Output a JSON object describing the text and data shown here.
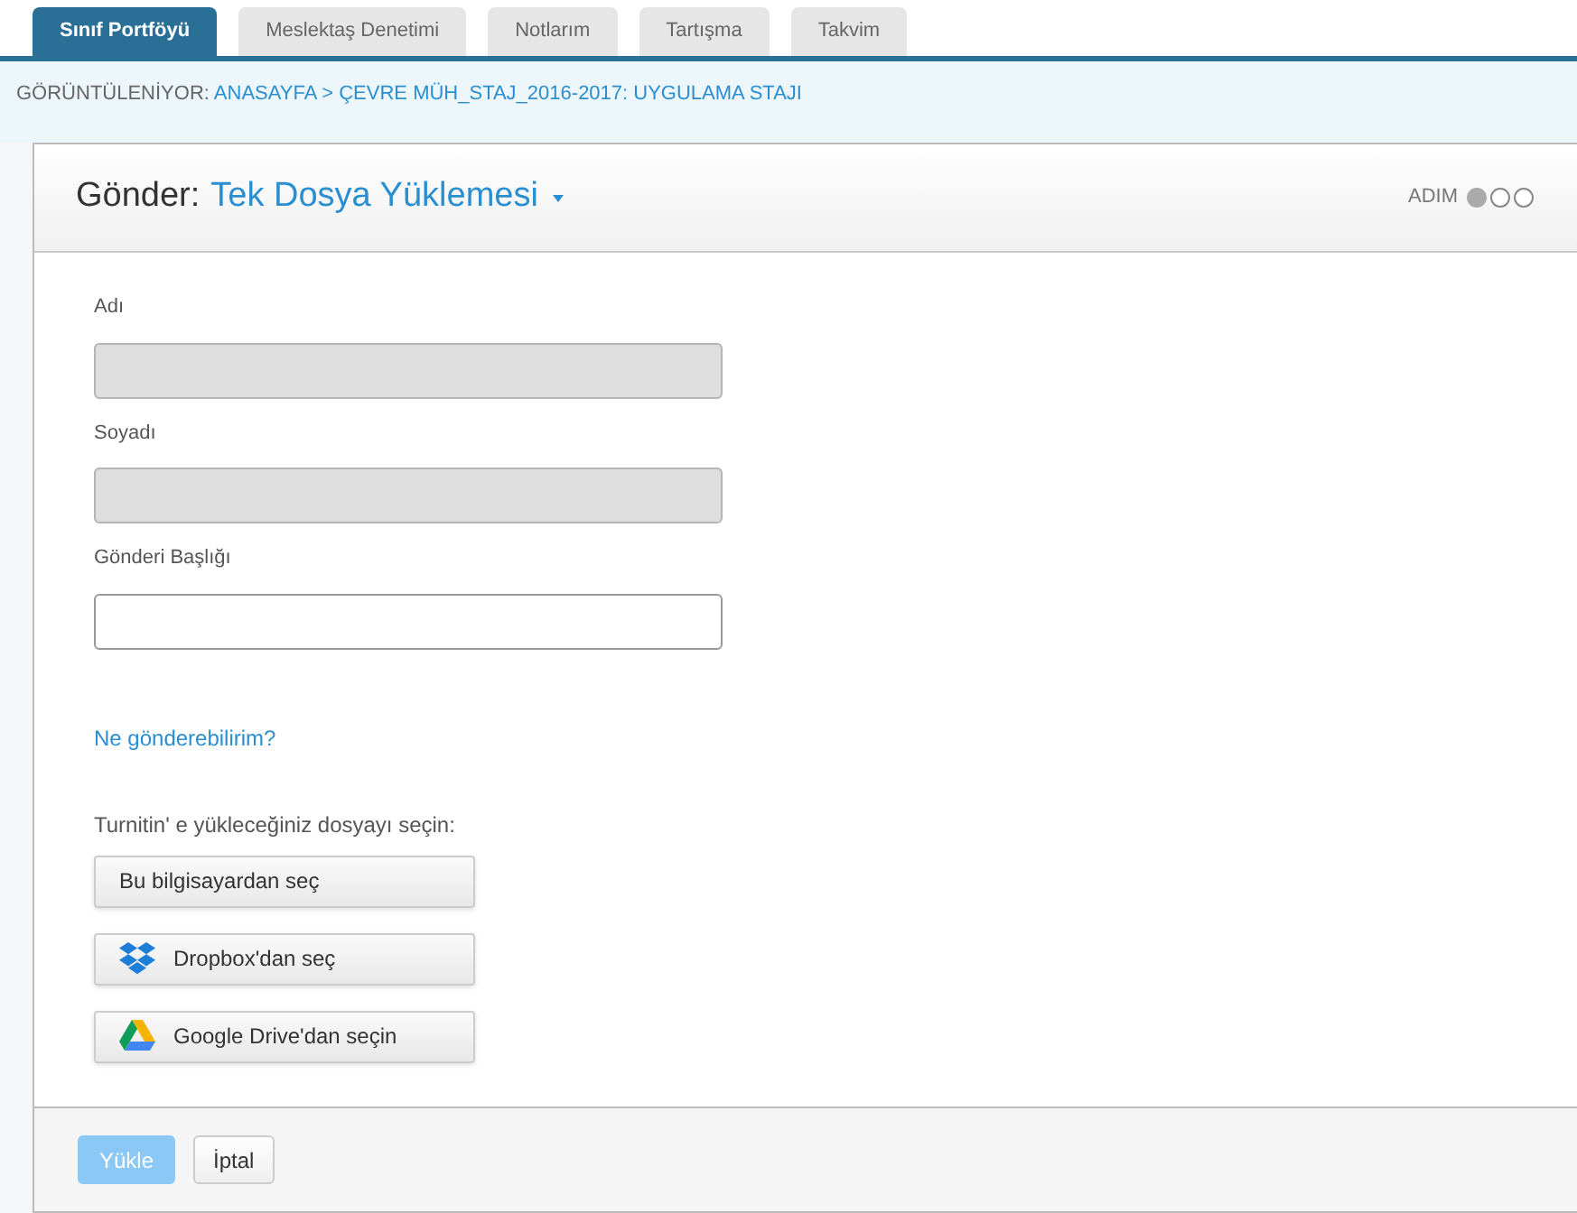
{
  "tabs": [
    {
      "label": "Sınıf Portföyü",
      "selected": true
    },
    {
      "label": "Meslektaş Denetimi",
      "selected": false
    },
    {
      "label": "Notlarım",
      "selected": false
    },
    {
      "label": "Tartışma",
      "selected": false
    },
    {
      "label": "Takvim",
      "selected": false
    }
  ],
  "breadcrumb": {
    "prefix": "GÖRÜNTÜLENİYOR:",
    "path": "ANASAYFA > ÇEVRE MÜH_STAJ_2016-2017: UYGULAMA STAJI"
  },
  "header": {
    "title": "Gönder:",
    "mode": "Tek Dosya Yüklemesi",
    "step_label": "ADIM",
    "steps": [
      {
        "selected": true
      },
      {
        "selected": false
      },
      {
        "selected": false
      }
    ]
  },
  "fields": [
    {
      "label": "Adı",
      "disabled": true
    },
    {
      "label": "Soyadı",
      "disabled": true
    },
    {
      "label": "Gönderi Başlığı",
      "disabled": false
    }
  ],
  "help_link": "Ne gönderebilirim?",
  "upload_prompt": "Turnitin' e yükleceğiniz dosyayı seçin:",
  "upload_buttons": [
    {
      "kind": "computer",
      "label": "Bu bilgisayardan seç"
    },
    {
      "kind": "dropbox",
      "label": "Dropbox'dan seç"
    },
    {
      "kind": "drive",
      "label": "Google Drive'dan seçin"
    }
  ],
  "footer": {
    "submit": {
      "label": "Yükle",
      "disabled": true
    },
    "cancel": {
      "label": "İptal"
    }
  }
}
